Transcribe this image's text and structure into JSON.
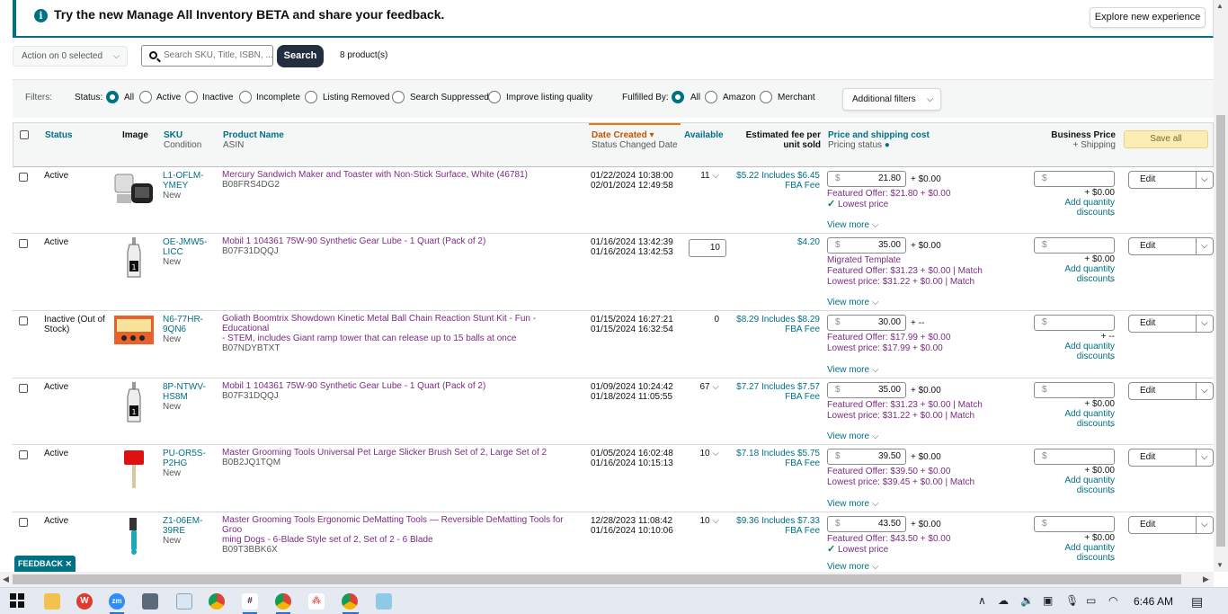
{
  "banner": {
    "message": "Try the new Manage All Inventory BETA and share your feedback.",
    "explore_label": "Explore new experience"
  },
  "toolbar": {
    "action_label": "Action on 0 selected",
    "search_placeholder": "Search SKU, Title, ISBN, ...",
    "search_label": "Search",
    "product_count": "8 product(s)"
  },
  "filters": {
    "label": "Filters:",
    "status_label": "Status:",
    "status_options": [
      "All",
      "Active",
      "Inactive",
      "Incomplete",
      "Listing Removed",
      "Search Suppressed",
      "Improve listing quality"
    ],
    "status_selected": "All",
    "fulfilled_label": "Fulfilled By:",
    "fulfilled_options": [
      "All",
      "Amazon",
      "Merchant"
    ],
    "fulfilled_selected": "All",
    "additional_label": "Additional filters"
  },
  "table": {
    "headers": {
      "status": "Status",
      "image": "Image",
      "sku": "SKU",
      "condition": "Condition",
      "product_name": "Product Name",
      "asin": "ASIN",
      "date_created": "Date Created",
      "status_changed": "Status Changed Date",
      "available": "Available",
      "fee_line1": "Estimated fee per",
      "fee_line2": "unit sold",
      "price_shipping": "Price and shipping cost",
      "pricing_status": "Pricing status",
      "business_price": "Business Price",
      "plus_shipping": "+ Shipping",
      "save_all": "Save all"
    },
    "rows": [
      {
        "status_line1": "Active",
        "status_line2": "",
        "sku_line1": "L1-OFLM-",
        "sku_line2": "YMEY",
        "condition": "New",
        "product_name_line1": "Mercury Sandwich Maker and Toaster with Non-Stick Surface, White (46781)",
        "product_name_line2": "",
        "asin": "B08FRS4DG2",
        "date_created": "01/22/2024 10:38:00",
        "status_changed": "02/01/2024 12:49:58",
        "available": "11",
        "available_editable": false,
        "fee_line1": "$5.22 Includes $6.45",
        "fee_line2": "FBA Fee",
        "price": "21.80",
        "shipping": "+ $0.00",
        "pricing_line1": "Featured Offer: $21.80 + $0.00",
        "pricing_line2": "Lowest price",
        "pricing_line2_check": true,
        "pricing_line3": "",
        "business_shipping": "+ $0.00",
        "quantity_discounts": "Add quantity discounts",
        "edit_label": "Edit",
        "view_more": "View more",
        "image_kind": "toaster"
      },
      {
        "status_line1": "Active",
        "status_line2": "",
        "sku_line1": "OE-JMW5-",
        "sku_line2": "LICC",
        "condition": "New",
        "product_name_line1": "Mobil 1 104361 75W-90 Synthetic Gear Lube - 1 Quart (Pack of 2)",
        "product_name_line2": "",
        "asin": "B07F31DQQJ",
        "date_created": "01/16/2024 13:42:39",
        "status_changed": "01/16/2024 13:42:53",
        "available": "10",
        "available_editable": true,
        "fee_line1": "$4.20",
        "fee_line2": "",
        "price": "35.00",
        "shipping": "+ $0.00",
        "pricing_line1": "Migrated Template",
        "pricing_line2": "Featured Offer: $31.23 + $0.00 | Match",
        "pricing_line2_check": false,
        "pricing_line3": "Lowest price: $31.22 + $0.00 | Match",
        "business_shipping": "+ $0.00",
        "quantity_discounts": "Add quantity discounts",
        "edit_label": "Edit",
        "view_more": "View more",
        "image_kind": "bottle"
      },
      {
        "status_line1": "Inactive (Out of",
        "status_line2": "Stock)",
        "sku_line1": "N6-77HR-",
        "sku_line2": "9QN6",
        "condition": "New",
        "product_name_line1": "Goliath Boomtrix Showdown Kinetic Metal Ball Chain Reaction Stunt Kit - Fun - Educational",
        "product_name_line2": "- STEM, includes Giant ramp tower that can release up to 15 balls at once",
        "asin": "B07NDYBTXT",
        "date_created": "01/15/2024 16:27:21",
        "status_changed": "01/15/2024 16:32:54",
        "available": "0",
        "available_editable": false,
        "fee_line1": "$8.29 Includes $8.29",
        "fee_line2": "FBA Fee",
        "price": "30.00",
        "shipping": "+ --",
        "pricing_line1": "Featured Offer: $17.99 + $0.00",
        "pricing_line2": "Lowest price: $17.99 + $0.00",
        "pricing_line2_check": false,
        "pricing_line3": "",
        "business_shipping": "+ --",
        "quantity_discounts": "Add quantity discounts",
        "edit_label": "Edit",
        "view_more": "View more",
        "image_kind": "toybox"
      },
      {
        "status_line1": "Active",
        "status_line2": "",
        "sku_line1": "8P-NTWV-",
        "sku_line2": "HS8M",
        "condition": "New",
        "product_name_line1": "Mobil 1 104361 75W-90 Synthetic Gear Lube - 1 Quart (Pack of 2)",
        "product_name_line2": "",
        "asin": "B07F31DQQJ",
        "date_created": "01/09/2024 10:24:42",
        "status_changed": "01/18/2024 11:05:55",
        "available": "67",
        "available_editable": false,
        "fee_line1": "$7.27 Includes $7.57",
        "fee_line2": "FBA Fee",
        "price": "35.00",
        "shipping": "+ $0.00",
        "pricing_line1": "Featured Offer: $31.23 + $0.00 | Match",
        "pricing_line2": "Lowest price: $31.22 + $0.00 | Match",
        "pricing_line2_check": false,
        "pricing_line3": "",
        "business_shipping": "+ $0.00",
        "quantity_discounts": "Add quantity discounts",
        "edit_label": "Edit",
        "view_more": "View more",
        "image_kind": "bottle"
      },
      {
        "status_line1": "Active",
        "status_line2": "",
        "sku_line1": "PU-OR5S-",
        "sku_line2": "P2HG",
        "condition": "New",
        "product_name_line1": "Master Grooming Tools Universal Pet Large Slicker Brush Set of 2, Large Set of 2",
        "product_name_line2": "",
        "asin": "B0B2JQ1TQM",
        "date_created": "01/05/2024 16:02:48",
        "status_changed": "01/16/2024 10:15:13",
        "available": "10",
        "available_editable": false,
        "fee_line1": "$7.18 Includes $5.75",
        "fee_line2": "FBA Fee",
        "price": "39.50",
        "shipping": "+ $0.00",
        "pricing_line1": "Featured Offer: $39.50 + $0.00",
        "pricing_line2": "Lowest price: $39.45 + $0.00 | Match",
        "pricing_line2_check": false,
        "pricing_line3": "",
        "business_shipping": "+ $0.00",
        "quantity_discounts": "Add quantity discounts",
        "edit_label": "Edit",
        "view_more": "View more",
        "image_kind": "brush"
      },
      {
        "status_line1": "Active",
        "status_line2": "",
        "sku_line1": "Z1-06EM-",
        "sku_line2": "39RE",
        "condition": "New",
        "product_name_line1": "Master Grooming Tools Ergonomic DeMatting Tools — Reversible DeMatting Tools for Groo",
        "product_name_line2": "ming Dogs - 6-Blade Style set of 2, Set of 2 - 6 Blade",
        "asin": "B09T3BBK6X",
        "date_created": "12/28/2023 11:08:42",
        "status_changed": "01/16/2024 10:10:06",
        "available": "10",
        "available_editable": false,
        "fee_line1": "$9.36 Includes $7.33",
        "fee_line2": "FBA Fee",
        "price": "43.50",
        "shipping": "+ $0.00",
        "pricing_line1": "Featured Offer: $43.50 + $0.00",
        "pricing_line2": "Lowest price",
        "pricing_line2_check": true,
        "pricing_line3": "",
        "business_shipping": "+ $0.00",
        "quantity_discounts": "Add quantity discounts",
        "edit_label": "Edit",
        "view_more": "View more",
        "image_kind": "rake"
      }
    ]
  },
  "feedback_label": "FEEDBACK ✕",
  "taskbar": {
    "clock": "6:46 AM",
    "apps": [
      "windows-start",
      "file-explorer",
      "wps-office",
      "zoom",
      "calculator",
      "paint",
      "chrome",
      "slack",
      "chrome-profile",
      "asana",
      "chrome-active",
      "notepad"
    ],
    "zoom_label": "zm"
  },
  "colors": {
    "link": "#007185",
    "product_link": "#7b2c82",
    "sort_accent": "#e47911",
    "save_all": "#fcedb4"
  }
}
